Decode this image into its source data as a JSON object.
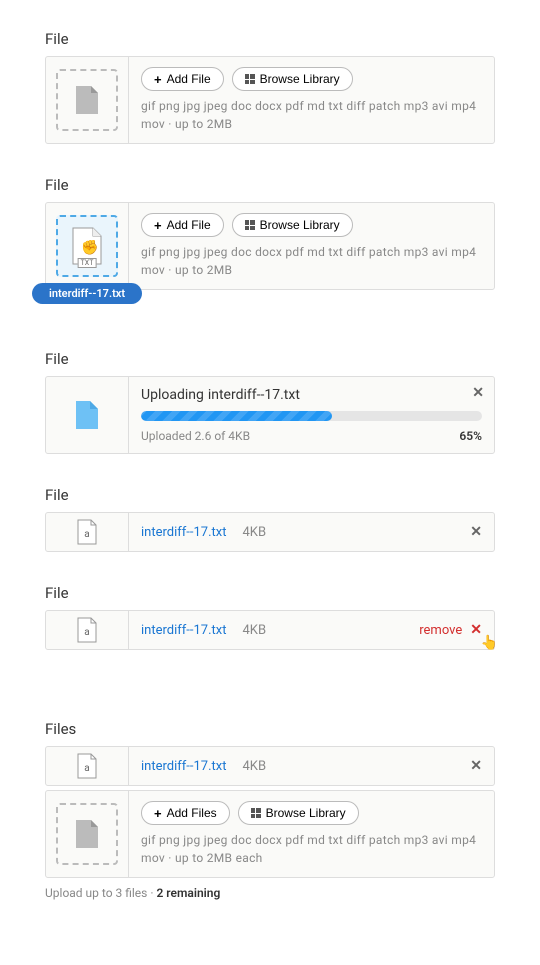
{
  "labels": {
    "file": "File",
    "files": "Files"
  },
  "buttons": {
    "addFile": "Add File",
    "addFiles": "Add Files",
    "browse": "Browse Library"
  },
  "hints": {
    "single": "gif  png  jpg  jpeg  doc  docx  pdf  md  txt  diff  patch  mp3  avi  mp4  mov   ·   up to 2MB",
    "multi": "gif  png  jpg  jpeg  doc  docx  pdf  md  txt  diff  patch  mp3  avi  mp4  mov   ·   up to 2MB each"
  },
  "drag": {
    "chip": "interdiff--17.txt",
    "ext": "TXT"
  },
  "upload": {
    "prefix": "Uploading ",
    "filename": "interdiff--17.txt",
    "progressText": "Uploaded 2.6 of 4KB",
    "percentLabel": "65%",
    "percentWidth": "56%"
  },
  "file": {
    "name": "interdiff--17.txt",
    "size": "4KB"
  },
  "remove": {
    "label": "remove"
  },
  "multi": {
    "name": "interdiff--17.txt",
    "size": "4KB"
  },
  "footer": {
    "prefix": "Upload up to 3 files   ·   ",
    "remaining": "2 remaining"
  }
}
